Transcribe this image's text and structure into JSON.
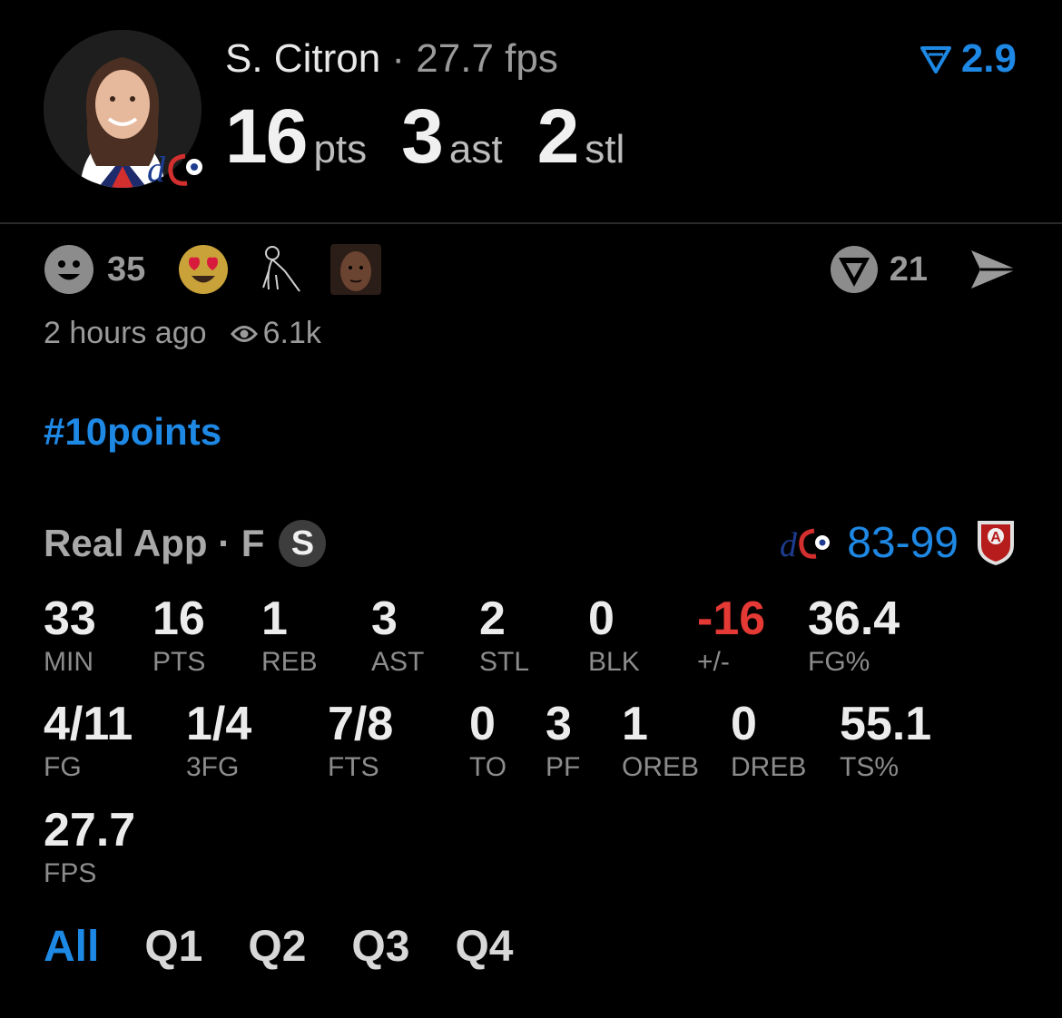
{
  "player": {
    "name": "S. Citron",
    "separator": " · ",
    "fps_text": "27.7 fps"
  },
  "headline_stats": [
    {
      "value": "16",
      "unit": "pts"
    },
    {
      "value": "3",
      "unit": "ast"
    },
    {
      "value": "2",
      "unit": "stl"
    }
  ],
  "projection": {
    "value": "2.9"
  },
  "reactions": {
    "count": "35",
    "icons": [
      "smiley-icon",
      "heart-eyes-emoji",
      "old-man-cane-sticker",
      "player-face-sticker"
    ]
  },
  "actions": {
    "comment_count": "21"
  },
  "meta": {
    "time": "2 hours ago",
    "views": "6.1k"
  },
  "hashtag": "#10points",
  "game": {
    "app_name": "Real App",
    "status": "F",
    "badge": "S",
    "score": "83-99",
    "home_logo_text": "dc",
    "away_logo_text": "A"
  },
  "stats_row1": [
    {
      "value": "33",
      "label": "MIN"
    },
    {
      "value": "16",
      "label": "PTS"
    },
    {
      "value": "1",
      "label": "REB"
    },
    {
      "value": "3",
      "label": "AST"
    },
    {
      "value": "2",
      "label": "STL"
    },
    {
      "value": "0",
      "label": "BLK"
    },
    {
      "value": "-16",
      "label": "+/-"
    },
    {
      "value": "36.4",
      "label": "FG%"
    }
  ],
  "stats_row2": [
    {
      "value": "4/11",
      "label": "FG"
    },
    {
      "value": "1/4",
      "label": "3FG"
    },
    {
      "value": "7/8",
      "label": "FTS"
    },
    {
      "value": "0",
      "label": "TO"
    },
    {
      "value": "3",
      "label": "PF"
    },
    {
      "value": "1",
      "label": "OREB"
    },
    {
      "value": "0",
      "label": "DREB"
    },
    {
      "value": "55.1",
      "label": "TS%"
    }
  ],
  "stats_row3": [
    {
      "value": "27.7",
      "label": "FPS"
    }
  ],
  "tabs": [
    {
      "label": "All",
      "active": true
    },
    {
      "label": "Q1",
      "active": false
    },
    {
      "label": "Q2",
      "active": false
    },
    {
      "label": "Q3",
      "active": false
    },
    {
      "label": "Q4",
      "active": false
    }
  ],
  "colors": {
    "accent": "#1e88e5",
    "negative": "#e53935",
    "background": "#000000",
    "muted": "#9a9a9a"
  }
}
